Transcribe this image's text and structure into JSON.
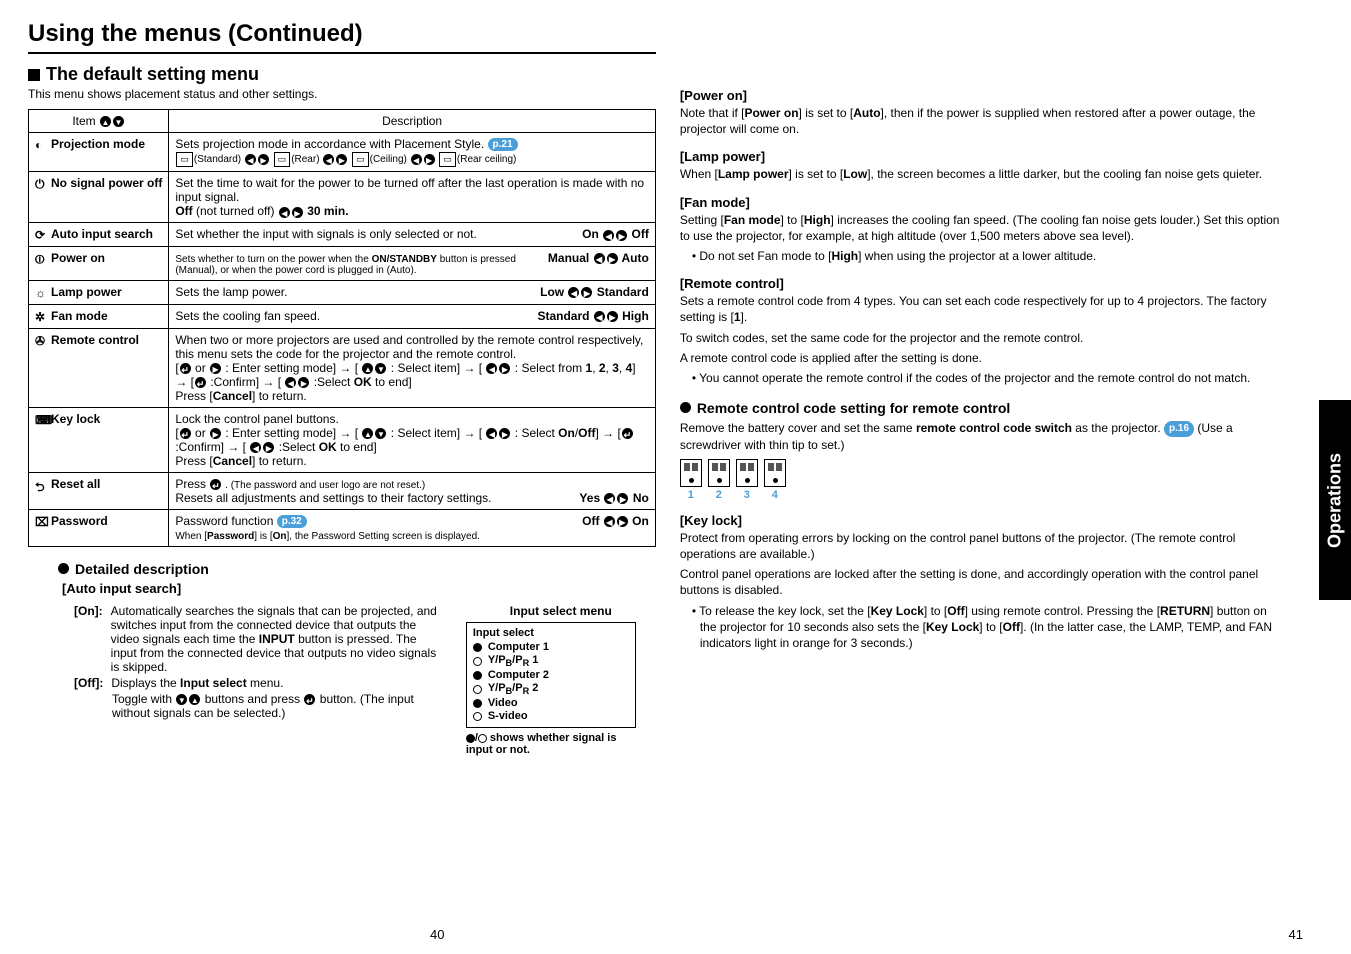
{
  "header": {
    "title": "Using the menus (Continued)"
  },
  "section": {
    "title": "The default setting menu",
    "subtitle": "This menu shows placement status and other settings."
  },
  "table": {
    "item_header": "Item",
    "desc_header": "Description",
    "rows": {
      "projection_mode": {
        "label": "Projection mode",
        "desc": "Sets projection mode in accordance with Placement Style.",
        "pref": "p.21",
        "opts": {
          "a": "(Standard)",
          "b": "(Rear)",
          "c": "(Ceiling)",
          "d": "(Rear ceiling)"
        }
      },
      "no_signal": {
        "label": "No signal power off",
        "l1": "Set the time to wait for the power to be turned off after the last operation is made with no input signal.",
        "l2a": "Off",
        "l2b": " (not turned off) ",
        "l2c": "30 min."
      },
      "auto_input": {
        "label": "Auto input search",
        "desc": "Set whether the input with signals is only selected or not.",
        "on": "On",
        "off": "Off"
      },
      "power_on": {
        "label": "Power on",
        "l1": "Sets whether to turn on the power when the ",
        "l1b": "ON/STANDBY",
        "l1c": " button is pressed (Manual), or when the power cord is plugged in (Auto).",
        "a": "Manual",
        "b": "Auto"
      },
      "lamp_power": {
        "label": "Lamp power",
        "desc": "Sets the lamp power.",
        "a": "Low",
        "b": "Standard"
      },
      "fan_mode": {
        "label": "Fan mode",
        "desc": "Sets the cooling fan speed.",
        "a": "Standard",
        "b": "High"
      },
      "remote_control": {
        "label": "Remote control",
        "l1": "When two or more projectors are used and controlled by the remote control respectively, this menu sets the code for the projector and the remote control.",
        "l2a": "[",
        "l2b": " or ",
        "l2c": " : Enter setting mode] → [ ",
        "l2d": " : Select item] → [ ",
        "l2e": " : Select from ",
        "l2f": "1",
        "l2g": ", ",
        "l2h": "2",
        "l2i": ", ",
        "l2j": "3",
        "l2k": ", ",
        "l2l": "4",
        "l2m": "] → [",
        "l2n": " :Confirm] → [ ",
        "l2o": " :Select ",
        "l2p": "OK",
        "l2q": " to end]",
        "l3": "Press [",
        "l3b": "Cancel",
        "l3c": "] to return."
      },
      "key_lock": {
        "label": "Key lock",
        "l1": "Lock the control panel buttons.",
        "l2a": "[",
        "l2b": " or ",
        "l2c": " : Enter setting mode] → [ ",
        "l2d": " : Select item] → [ ",
        "l2e": " : Select ",
        "l2f": "On",
        "l2g": "/",
        "l2h": "Off",
        "l2i": "] → [",
        "l2j": " :Confirm] → [ ",
        "l2k": " :Select ",
        "l2l": "OK",
        "l2m": " to end]",
        "l3": "Press [",
        "l3b": "Cancel",
        "l3c": "] to return."
      },
      "reset_all": {
        "label": "Reset all",
        "l1": "Press ",
        "l1b": " . (The password and user logo are not reset.)",
        "l2": "Resets all adjustments and settings to their factory settings.",
        "a": "Yes",
        "b": "No"
      },
      "password": {
        "label": "Password",
        "l1": "Password function ",
        "pref": "p.32",
        "l2a": "When [",
        "l2b": "Password",
        "l2c": "] is [",
        "l2d": "On",
        "l2e": "], the Password Setting screen is displayed.",
        "a": "Off",
        "b": "On"
      }
    }
  },
  "detailed": {
    "title": "Detailed description",
    "auto_input": {
      "title": "[Auto input search]",
      "on_label": "[On]:",
      "on_desc": "Automatically searches the signals that can be projected, and switches input from the connected device that outputs the video signals each time the INPUT button is pressed. The input from the connected device that outputs no video signals is skipped.",
      "off_label": "[Off]:",
      "off_desc": "Displays the Input select menu.",
      "off_sub": "Toggle with   buttons and press  button. (The input without signals can be selected.)"
    }
  },
  "input_menu": {
    "title": "Input select menu",
    "header": "Input select",
    "items": {
      "a": "Computer 1",
      "b": "Y/PB/PR 1",
      "c": "Computer 2",
      "d": "Y/PB/PR 2",
      "e": "Video",
      "f": "S-video"
    },
    "note": "/ shows whether signal is input or not."
  },
  "right": {
    "power_on": {
      "title": "[Power on]",
      "p1a": "Note that if [",
      "p1b": "Power on",
      "p1c": "] is set to [",
      "p1d": "Auto",
      "p1e": "], then if the power is supplied when restored after a power outage, the projector will come on."
    },
    "lamp_power": {
      "title": "[Lamp power]",
      "p1a": "When [",
      "p1b": "Lamp power",
      "p1c": "] is set to [",
      "p1d": "Low",
      "p1e": "], the screen becomes a little darker, but the cooling fan noise gets quieter."
    },
    "fan_mode": {
      "title": "[Fan mode]",
      "p1a": "Setting [",
      "p1b": "Fan mode",
      "p1c": "] to [",
      "p1d": "High",
      "p1e": "] increases the cooling fan speed. (The cooling fan noise gets louder.) Set this option to use the projector, for example, at high altitude (over 1,500 meters above sea level).",
      "li1a": "Do not set Fan mode to [",
      "li1b": "High",
      "li1c": "] when using the projector at a lower altitude."
    },
    "remote_control": {
      "title": "[Remote control]",
      "p1": "Sets a remote control code from 4 types. You can set each code respectively for up to 4 projectors. The factory setting is [1].",
      "p2": "To switch codes, set the same code for the projector and the remote control.",
      "p3": "A remote control code is applied after the setting is done.",
      "li1": "You cannot operate the remote control if the codes of the projector and the remote control do not match."
    },
    "remote_code": {
      "title": "Remote control code setting for remote control",
      "p1a": "Remove the battery cover and set the same ",
      "p1b": "remote control code switch",
      "p1c": " as the projector. ",
      "pref": "p.16",
      "p1d": " (Use a screwdriver with thin tip to set.)"
    },
    "key_lock": {
      "title": "[Key lock]",
      "p1": "Protect from operating errors by locking on the control panel buttons of the projector. (The remote control operations are available.)",
      "p2": "Control panel operations are locked after the setting is done, and accordingly operation with the control panel buttons is disabled.",
      "li1a": "To release the key lock, set the [",
      "li1b": "Key Lock",
      "li1c": "] to [",
      "li1d": "Off",
      "li1e": "] using remote control. Pressing the [",
      "li1f": "RETURN",
      "li1g": "] button on the projector for 10 seconds also sets the [",
      "li1h": "Key Lock",
      "li1i": "] to [",
      "li1j": "Off",
      "li1k": "]. (In the latter case, the LAMP, TEMP, and FAN indicators light in orange for 3 seconds.)"
    }
  },
  "tab": "Operations",
  "pages": {
    "left": "40",
    "right": "41"
  },
  "switch_nums": {
    "a": "1",
    "b": "2",
    "c": "3",
    "d": "4"
  }
}
